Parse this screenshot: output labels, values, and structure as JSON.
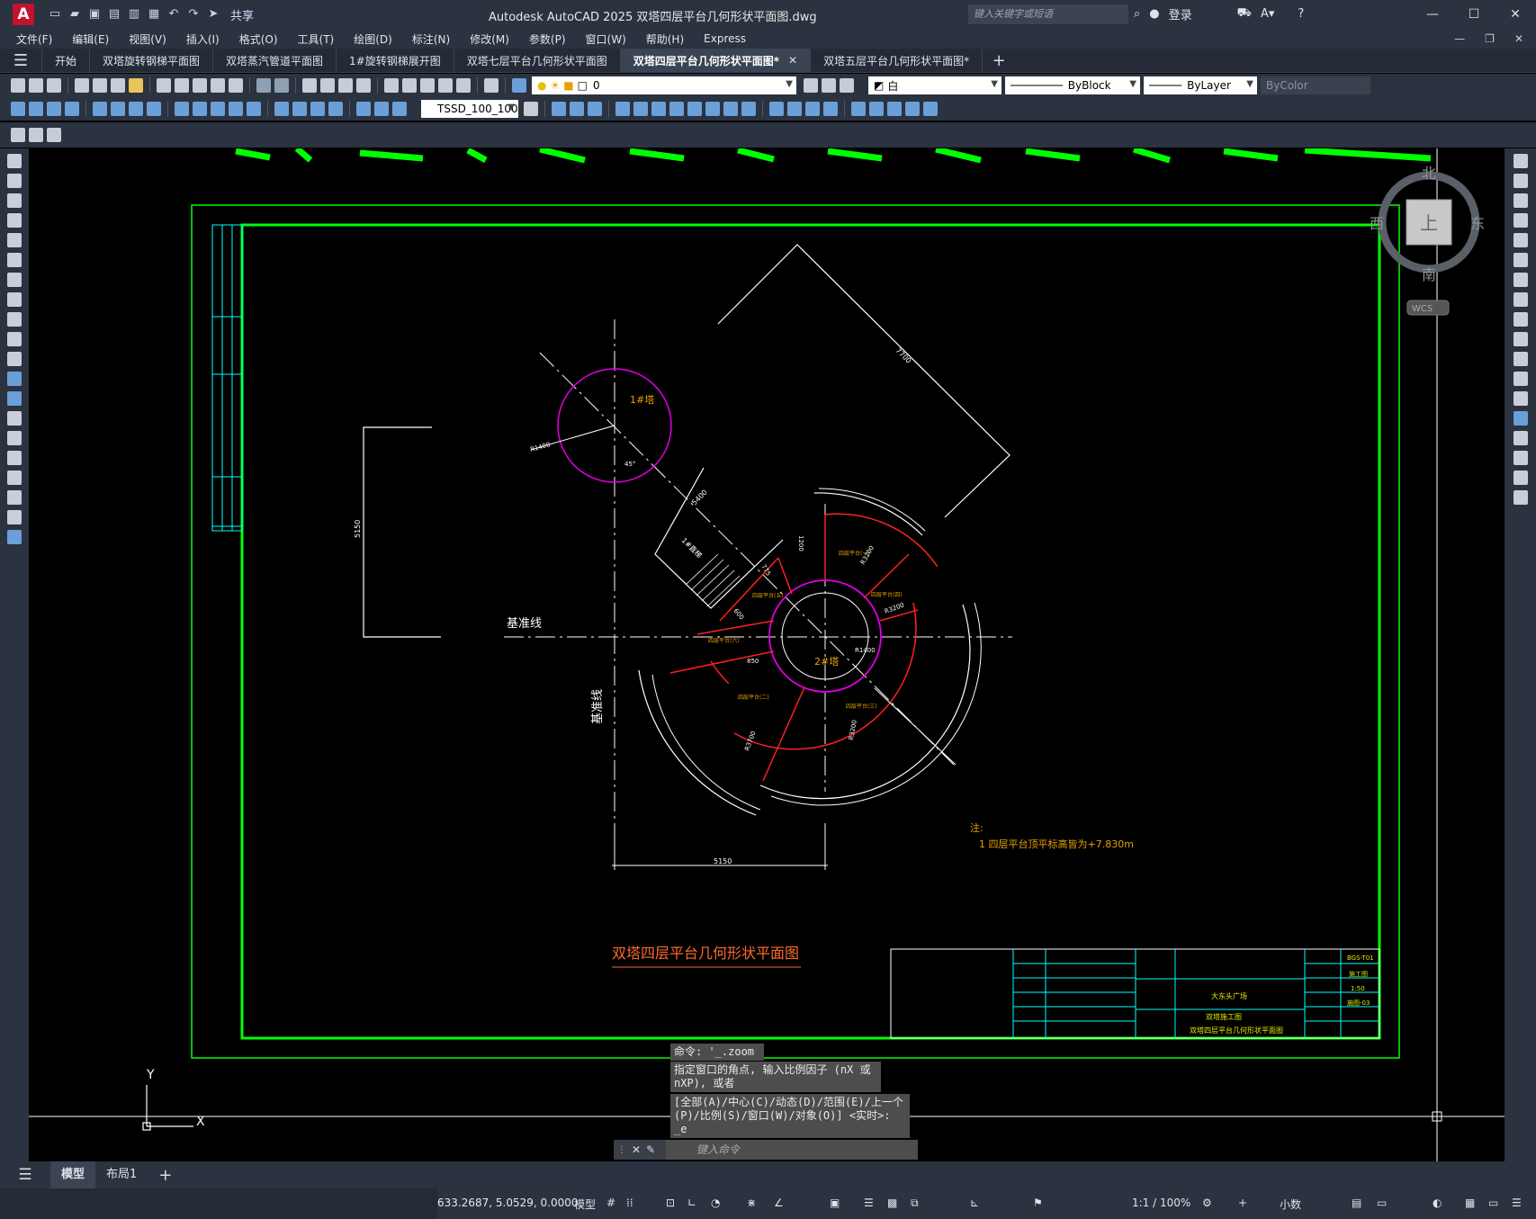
{
  "app": {
    "logo_letter": "A",
    "window_title": "Autodesk AutoCAD 2025    双塔四层平台几何形状平面图.dwg",
    "share_label": "共享",
    "search_placeholder": "键入关键字或短语",
    "login_label": "登录",
    "help_label": "?"
  },
  "menu": [
    "文件(F)",
    "编辑(E)",
    "视图(V)",
    "插入(I)",
    "格式(O)",
    "工具(T)",
    "绘图(D)",
    "标注(N)",
    "修改(M)",
    "参数(P)",
    "窗口(W)",
    "帮助(H)",
    "Express"
  ],
  "tabs": [
    {
      "label": "开始",
      "active": false
    },
    {
      "label": "双塔旋转钢梯平面图",
      "active": false
    },
    {
      "label": "双塔蒸汽管道平面图",
      "active": false
    },
    {
      "label": "1#旋转钢梯展开图",
      "active": false
    },
    {
      "label": "双塔七层平台几何形状平面图",
      "active": false
    },
    {
      "label": "双塔四层平台几何形状平面图*",
      "active": true
    },
    {
      "label": "双塔五层平台几何形状平面图*",
      "active": false
    }
  ],
  "toolbar": {
    "layer_value": "0",
    "color_value": "白",
    "linetype_value": "ByBlock",
    "lineweight_value": "ByLayer",
    "plotstyle_value": "ByColor",
    "textstyle_value": "TSSD_100_100"
  },
  "viewcube": {
    "north": "北",
    "south": "南",
    "east": "东",
    "west": "西",
    "face": "上",
    "wcs": "WCS"
  },
  "drawing": {
    "title": "双塔四层平台几何形状平面图",
    "baseline_label": "基准线",
    "baseline_label2": "基准线",
    "tower1": "1#塔",
    "tower2": "2#塔",
    "stair1": "1#直梯",
    "dims": {
      "d7700": "7700",
      "d5400": "5400",
      "d5150v": "5150",
      "d5150h": "5150",
      "r1400a": "R1400",
      "r1400b": "R1400",
      "a45": "45°",
      "r3200": "R3200",
      "r3700": "R3700",
      "r3200b": "R3200",
      "r3200c": "R3200",
      "d850": "850",
      "d775": "775",
      "d600": "600",
      "d1200": "1200"
    },
    "note_title": "注:",
    "note_1": "1 四层平台顶平标高皆为+7.830m",
    "platforms": {
      "p1": "四层平台(一)",
      "p2": "四层平台(二)",
      "p3": "四层平台(三)",
      "p4": "四层平台(四)",
      "p5": "四层平台(五)",
      "p6": "四层平台(六)"
    }
  },
  "titleblock": {
    "project": "大东头广场",
    "drawing_name": "双塔四层平台几何形状平面图",
    "work": "双塔施工图",
    "scale": "1:50",
    "stage": "施工图",
    "number": "施图-03",
    "code": "BGS-T01"
  },
  "command": {
    "line1": "命令: '_.zoom",
    "line2": "指定窗口的角点, 输入比例因子 (nX 或 nXP), 或者",
    "line3": "[全部(A)/中心(C)/动态(D)/范围(E)/上一个(P)/比例(S)/窗口(W)/对象(O)] <实时>: _e",
    "input_placeholder": "键入命令"
  },
  "layouts": [
    {
      "label": "模型",
      "active": true
    },
    {
      "label": "布局1",
      "active": false
    }
  ],
  "status": {
    "coordinates": "633.2687, 5.0529, 0.0000",
    "model_label": "模型",
    "scale_label": "1:1 / 100%",
    "units_label": "小数"
  },
  "ucs": {
    "x": "X",
    "y": "Y"
  }
}
